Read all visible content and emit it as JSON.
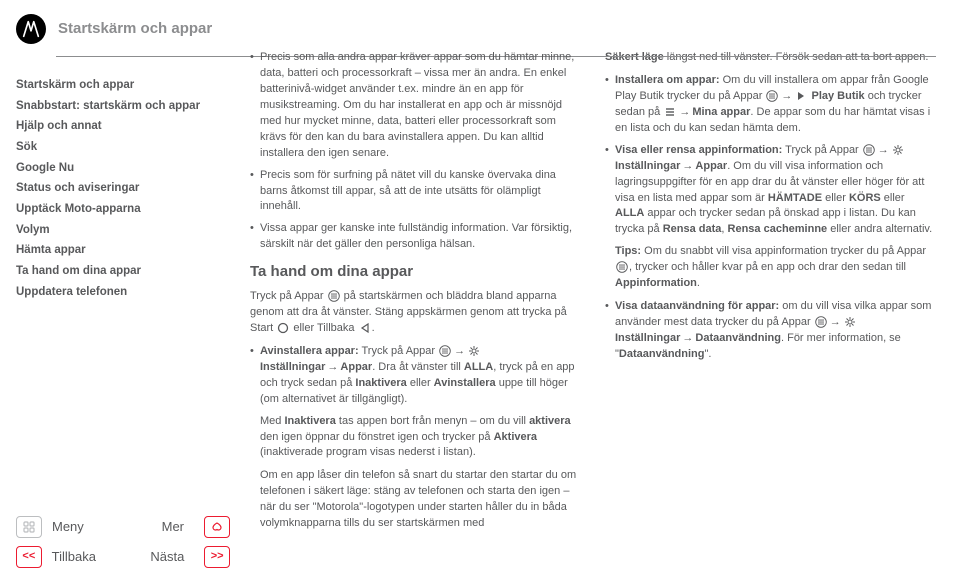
{
  "header": {
    "title": "Startskärm och appar"
  },
  "sidebar": {
    "items": [
      "Startskärm och appar",
      "Snabbstart: startskärm och appar",
      "Hjälp och annat",
      "Sök",
      "Google Nu",
      "Status och aviseringar",
      "Upptäck Moto-apparna",
      "Volym",
      "Hämta appar",
      "Ta hand om dina appar",
      "Uppdatera telefonen"
    ],
    "footer": {
      "menu": "Meny",
      "more": "Mer",
      "back": "Tillbaka",
      "next": "Nästa"
    }
  },
  "col1": {
    "b1_a": "Precis som alla andra appar kräver appar som du hämtar minne, data, batteri och processorkraft – vissa mer än andra. En enkel batterinivå-widget använder t.ex. mindre än en app för musikstreaming. Om du har installerat en app och är missnöjd med hur mycket minne, data, batteri eller processorkraft som krävs för den kan du bara avinstallera appen. Du kan alltid installera den igen senare.",
    "b2": "Precis som för surfning på nätet vill du kanske övervaka dina barns åtkomst till appar, så att de inte utsätts för olämpligt innehåll.",
    "b3": "Vissa appar ger kanske inte fullständig information. Var försiktig, särskilt när det gäller den personliga hälsan.",
    "h2": "Ta hand om dina appar",
    "p1_a": "Tryck på Appar ",
    "p1_b": " på startskärmen och bläddra bland apparna genom att dra åt vänster. Stäng appskärmen genom att trycka på Start ",
    "p1_c": " eller Tillbaka ",
    "p1_d": ".",
    "li1_a": "Avinstallera appar:",
    "li1_b": " Tryck på Appar ",
    "li1_c": "Inställningar",
    "li1_d": "Appar",
    "li1_e": ". Dra åt vänster till ",
    "li1_f": "ALLA",
    "li1_g": ", tryck på en app och tryck sedan på ",
    "li1_h": "Inaktivera",
    "li1_i": " eller ",
    "li1_j": "Avinstallera",
    "li1_k": " uppe till höger (om alternativet är tillgängligt).",
    "p2_a": "Med ",
    "p2_b": "Inaktivera",
    "p2_c": " tas appen bort från menyn – om du vill ",
    "p2_d": "aktivera",
    "p2_e": " den igen öppnar du fönstret igen och trycker på ",
    "p2_f": "Aktivera",
    "p2_g": " (inaktiverade program visas nederst i listan).",
    "p3": "Om en app låser din telefon så snart du startar den startar du om telefonen i säkert läge: stäng av telefonen och starta den igen – när du ser \"Motorola\"-logotypen under starten håller du in båda volymknapparna tills du ser startskärmen med"
  },
  "col2": {
    "p0_a": "Säkert läge",
    "p0_b": " längst ned till vänster. Försök sedan att ta bort appen.",
    "li1_a": "Installera om appar:",
    "li1_b": " Om du vill installera om appar från Google Play Butik trycker du på Appar ",
    "li1_c": "Play Butik",
    "li1_d": " och trycker sedan på ",
    "li1_e": "Mina appar",
    "li1_f": ". De appar som du har hämtat visas i en lista och du kan sedan hämta dem.",
    "li2_a": "Visa eller rensa appinformation:",
    "li2_b": " Tryck på Appar ",
    "li2_c": "Inställningar",
    "li2_d": "Appar",
    "li2_e": ". Om du vill visa information och lagringsuppgifter för en app drar du åt vänster eller höger för att visa en lista med appar som är ",
    "li2_f": "HÄMTADE",
    "li2_g": " eller ",
    "li2_h": "KÖRS",
    "li2_i": " eller ",
    "li2_j": "ALLA",
    "li2_k": " appar och trycker sedan på önskad app i listan. Du kan trycka på ",
    "li2_l": "Rensa data",
    "li2_m": ", ",
    "li2_n": "Rensa cacheminne",
    "li2_o": " eller andra alternativ.",
    "tips_a": "Tips:",
    "tips_b": " Om du snabbt vill visa appinformation trycker du på Appar ",
    "tips_c": ", trycker och håller kvar på en app och drar den sedan till ",
    "tips_d": "Appinformation",
    "tips_e": ".",
    "li3_a": "Visa dataanvändning för appar:",
    "li3_b": " om du vill visa vilka appar som använder mest data trycker du på Appar ",
    "li3_c": "Inställningar",
    "li3_d": "Dataanvändning",
    "li3_e": ". För mer information, se \"",
    "li3_f": "Dataanvändning",
    "li3_g": "\"."
  }
}
